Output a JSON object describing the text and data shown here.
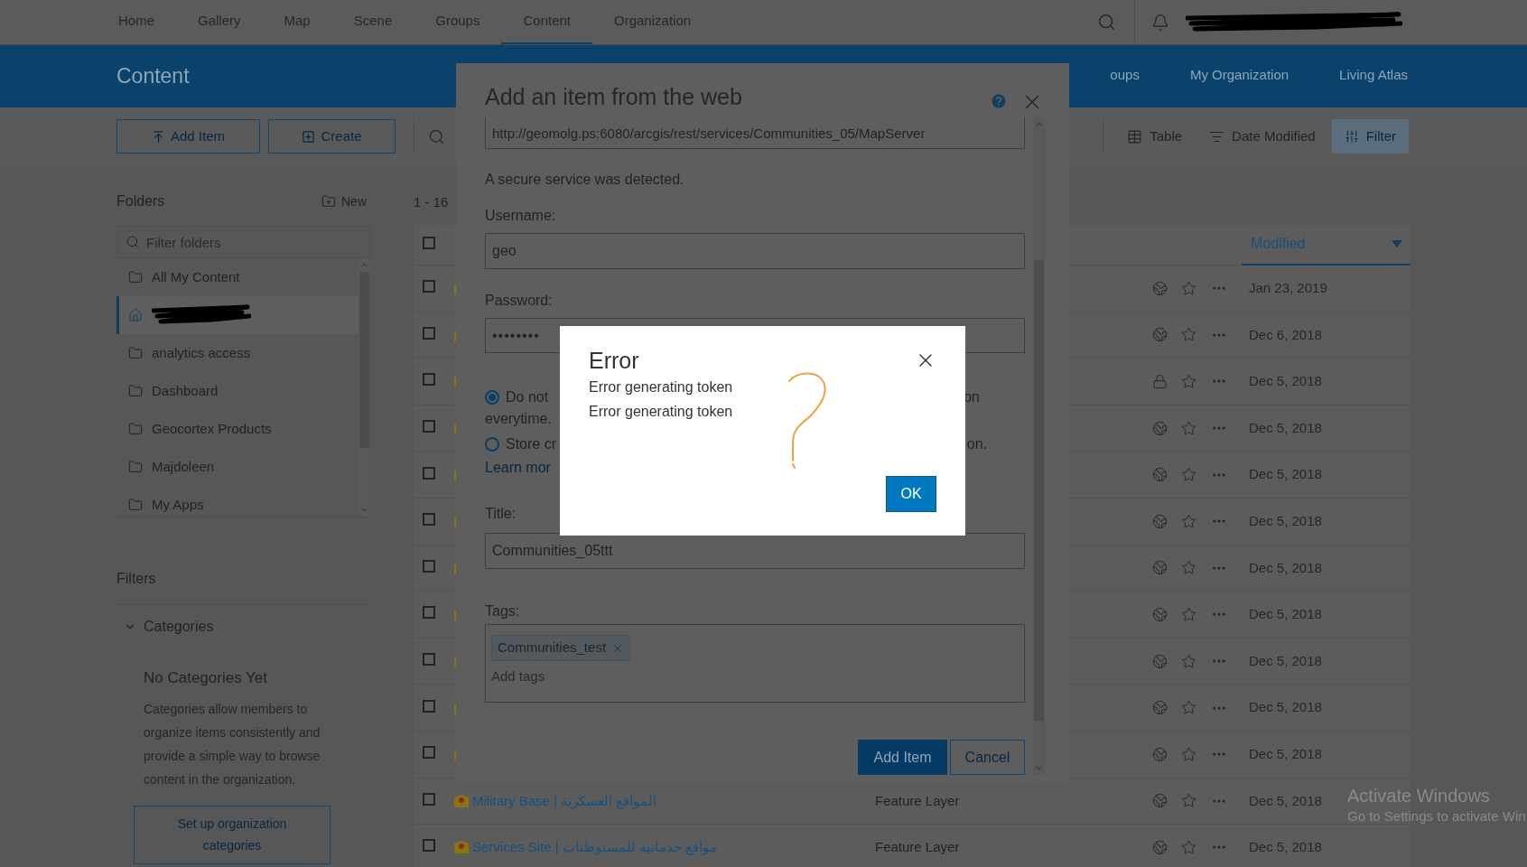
{
  "top_nav": {
    "items": [
      {
        "label": "Home",
        "selected": false
      },
      {
        "label": "Gallery",
        "selected": false
      },
      {
        "label": "Map",
        "selected": false
      },
      {
        "label": "Scene",
        "selected": false
      },
      {
        "label": "Groups",
        "selected": false
      },
      {
        "label": "Content",
        "selected": true
      },
      {
        "label": "Organization",
        "selected": false
      }
    ]
  },
  "header": {
    "title": "Content",
    "tabs": [
      {
        "label": "oups",
        "selected": false
      },
      {
        "label": "My Organization",
        "selected": false
      },
      {
        "label": "Living Atlas",
        "selected": false
      }
    ]
  },
  "toolbar": {
    "add_item": "Add Item",
    "create": "Create",
    "view": "Table",
    "sort": "Date Modified",
    "filter": {
      "label": "Filter",
      "on": true
    }
  },
  "folders": {
    "title": "Folders",
    "new": "New",
    "placeholder": "Filter folders",
    "items": [
      {
        "kind": "folder",
        "label": "All My Content",
        "selected": false
      },
      {
        "kind": "home",
        "selected": true
      },
      {
        "kind": "folder",
        "label": "analytics access",
        "selected": false
      },
      {
        "kind": "folder",
        "label": "Dashboard",
        "selected": false
      },
      {
        "kind": "folder",
        "label": "Geocortex Products",
        "selected": false
      },
      {
        "kind": "folder",
        "label": "Majdoleen",
        "selected": false
      },
      {
        "kind": "folder",
        "label": "My Apps",
        "selected": false
      }
    ]
  },
  "filters": {
    "title": "Filters",
    "categories": {
      "label": "Categories",
      "expanded": true,
      "empty_title": "No Categories Yet",
      "description": "Categories allow members to organize items consistently and provide a simple way to browse content in the organization.",
      "button": "Set up organization categories"
    }
  },
  "results": {
    "count": "1 - 16",
    "all_checked": false,
    "sort_column": "Modified",
    "rows": [
      {
        "checked": false,
        "locked": false,
        "modified": "Jan 23, 2019"
      },
      {
        "checked": false,
        "locked": false,
        "modified": "Dec 6, 2018"
      },
      {
        "checked": false,
        "locked": true,
        "modified": "Dec 5, 2018"
      },
      {
        "checked": false,
        "locked": false,
        "modified": "Dec 5, 2018"
      },
      {
        "checked": false,
        "locked": false,
        "modified": "Dec 5, 2018"
      },
      {
        "checked": false,
        "locked": false,
        "modified": "Dec 5, 2018"
      },
      {
        "checked": false,
        "locked": false,
        "modified": "Dec 5, 2018"
      },
      {
        "checked": false,
        "locked": false,
        "modified": "Dec 5, 2018"
      },
      {
        "checked": false,
        "locked": false,
        "modified": "Dec 5, 2018"
      },
      {
        "checked": false,
        "locked": false,
        "modified": "Dec 5, 2018"
      },
      {
        "checked": false,
        "locked": false,
        "modified": "Dec 5, 2018"
      },
      {
        "checked": false,
        "title": "Military Base | المواقع العسكرية",
        "type": "Feature Layer",
        "locked": false,
        "modified": "Dec 5, 2018"
      },
      {
        "checked": false,
        "title": "Services Site | مواقع خدماتية للمستوطنات",
        "type": "Feature Layer",
        "locked": false,
        "modified": "Dec 5, 2018"
      }
    ]
  },
  "add_item_dialog": {
    "title": "Add an item from the web",
    "url": "http://geomolg.ps:6080/arcgis/rest/services/Communities_05/MapServer",
    "notice": "A secure service was detected.",
    "username_label": "Username:",
    "username": "geo",
    "password_label": "Password:",
    "password": "••••••••",
    "options": [
      {
        "left": "Do not",
        "right": "on",
        "continuation": "everytime.",
        "selected": true
      },
      {
        "left": "Store cr",
        "right": "on.",
        "selected": false
      }
    ],
    "learn_more": "Learn mor",
    "title_label": "Title:",
    "title_value": "Communities_05ttt",
    "tags_label": "Tags:",
    "tags": [
      "Communities_test"
    ],
    "tags_placeholder": "Add tags",
    "add_button": "Add Item",
    "cancel_button": "Cancel"
  },
  "error_dialog": {
    "title": "Error",
    "messages": [
      "Error generating token",
      "Error generating token"
    ],
    "button": "OK"
  },
  "os_notice": {
    "title": "Activate Windows",
    "subtitle": "Go to Settings to activate Win"
  }
}
